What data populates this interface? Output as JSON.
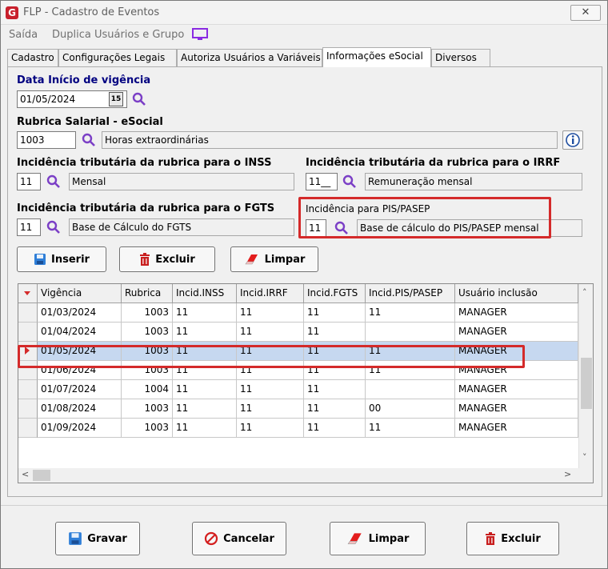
{
  "window": {
    "title": "FLP - Cadastro de Eventos",
    "close_label": "✕"
  },
  "menu": {
    "saida": "Saída",
    "duplica": "Duplica Usuários e Grupo"
  },
  "tabs": [
    {
      "label": "Cadastro",
      "active": false
    },
    {
      "label": "Configurações Legais",
      "active": false
    },
    {
      "label": "Autoriza Usuários a Variáveis",
      "active": false
    },
    {
      "label": "Informações eSocial",
      "active": true
    },
    {
      "label": "Diversos",
      "active": false
    }
  ],
  "form": {
    "data_inicio_label": "Data Início de vigência",
    "data_inicio_value": "01/05/2024",
    "calendar_btn_label": "15",
    "rubrica_label": "Rubrica Salarial - eSocial",
    "rubrica_code": "1003",
    "rubrica_desc": "Horas extraordinárias",
    "inss_label": "Incidência tributária da rubrica para o INSS",
    "inss_code": "11",
    "inss_desc": "Mensal",
    "irrf_label": "Incidência tributária da rubrica para o IRRF",
    "irrf_code": "11__",
    "irrf_desc": "Remuneração mensal",
    "fgts_label": "Incidência tributária da rubrica para o FGTS",
    "fgts_code": "11",
    "fgts_desc": "Base de Cálculo do FGTS",
    "pis_label": "Incidência para PIS/PASEP",
    "pis_code": "11",
    "pis_desc": "Base de cálculo do PIS/PASEP mensal"
  },
  "actions": {
    "inserir": "Inserir",
    "excluir": "Excluir",
    "limpar": "Limpar"
  },
  "grid": {
    "headers": [
      "Vigência",
      "Rubrica",
      "Incid.INSS",
      "Incid.IRRF",
      "Incid.FGTS",
      "Incid.PIS/PASEP",
      "Usuário inclusão"
    ],
    "rows": [
      [
        "01/03/2024",
        "1003",
        "11",
        "11",
        "11",
        "11",
        "MANAGER"
      ],
      [
        "01/04/2024",
        "1003",
        "11",
        "11",
        "11",
        "",
        "MANAGER"
      ],
      [
        "01/05/2024",
        "1003",
        "11",
        "11",
        "11",
        "11",
        "MANAGER"
      ],
      [
        "01/06/2024",
        "1003",
        "11",
        "11",
        "11",
        "11",
        "MANAGER"
      ],
      [
        "01/07/2024",
        "1004",
        "11",
        "11",
        "11",
        "",
        "MANAGER"
      ],
      [
        "01/08/2024",
        "1003",
        "11",
        "11",
        "11",
        "00",
        "MANAGER"
      ],
      [
        "01/09/2024",
        "1003",
        "11",
        "11",
        "11",
        "11",
        "MANAGER"
      ]
    ],
    "selected_index": 2
  },
  "footer": {
    "gravar": "Gravar",
    "cancelar": "Cancelar",
    "limpar": "Limpar",
    "excluir": "Excluir"
  },
  "colors": {
    "highlight_red": "#d42a2a",
    "label_blue": "#000080",
    "search_purple": "#7b3fc6",
    "selected_row": "#c6d8f0"
  }
}
